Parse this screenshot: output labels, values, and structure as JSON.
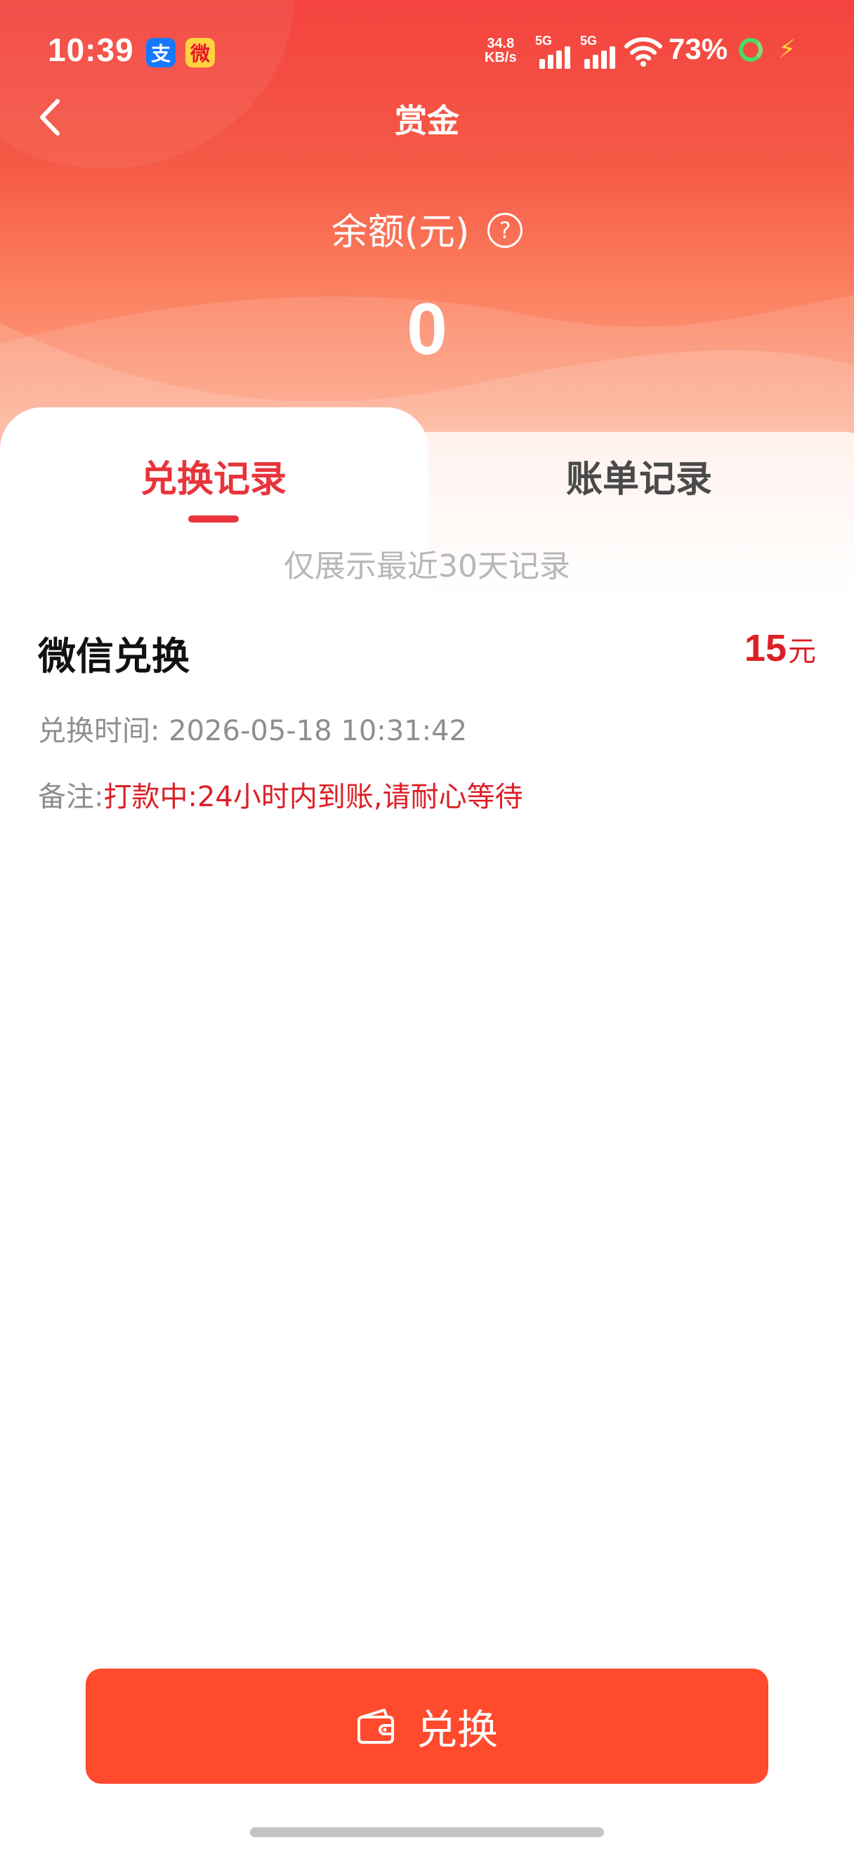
{
  "status_bar": {
    "time": "10:39",
    "net_speed_value": "34.8",
    "net_speed_unit": "KB/s",
    "sim1": "5G",
    "sim2": "5G",
    "battery": "73%",
    "alipay_icon_glyph": "支",
    "weibo_icon_glyph": "微"
  },
  "nav": {
    "title": "赏金"
  },
  "balance": {
    "label": "余额(元)",
    "help_glyph": "?",
    "value": "0"
  },
  "tabs": [
    {
      "label": "兑换记录",
      "active": true
    },
    {
      "label": "账单记录",
      "active": false
    }
  ],
  "notice": "仅展示最近30天记录",
  "record": {
    "title": "微信兑换",
    "amount": "15",
    "unit": "元",
    "time_label": "兑换时间:",
    "time_value": "2026-05-18 10:31:42",
    "note_label": "备注:",
    "note_value": "打款中:24小时内到账,请耐心等待"
  },
  "bottom_button": {
    "label": "兑换",
    "icon": "wallet-icon"
  },
  "colors": {
    "accent_red": "#e8343a",
    "amount_red": "#dc1f26",
    "button_orange": "#ff4a2d"
  }
}
